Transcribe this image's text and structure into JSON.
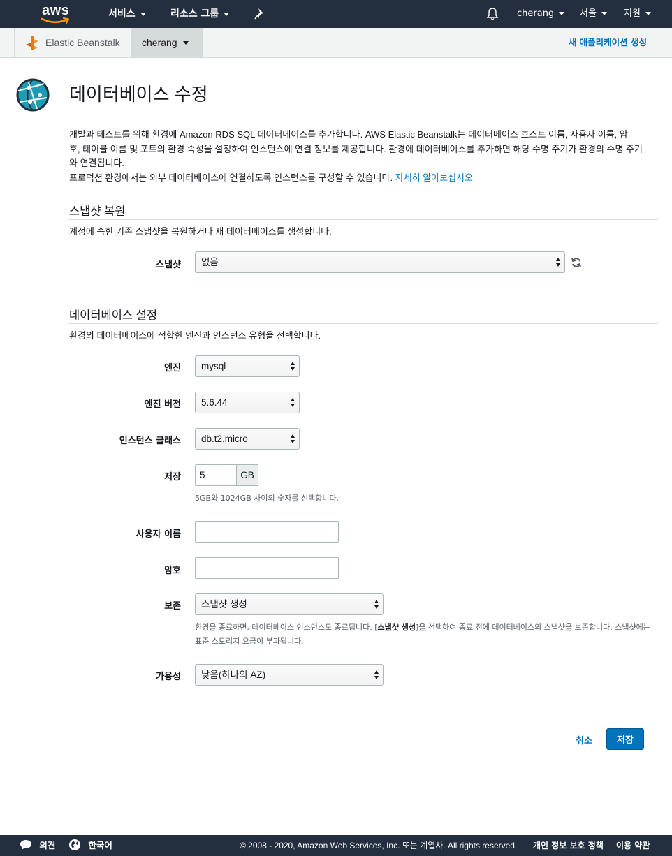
{
  "nav": {
    "logo": "aws",
    "services": "서비스",
    "resource_groups": "리소스 그룹",
    "user": "cherang",
    "region": "서울",
    "support": "지원"
  },
  "subnav": {
    "app_name": "Elastic Beanstalk",
    "environment": "cherang",
    "create_app": "새 애플리케이션 생성"
  },
  "page": {
    "title": "데이터베이스 수정",
    "intro_line1": "개발과 테스트를 위해 환경에 Amazon RDS SQL 데이터베이스를 추가합니다. AWS Elastic Beanstalk는 데이터베이스 호스트 이름, 사용자 이름, 암",
    "intro_line2": "호, 테이블 이름 및 포트의 환경 속성을 설정하여 인스턴스에 연결 정보를 제공합니다. 환경에 데이터베이스를 추가하면 해당 수명 주기가 환경의 수명 주기",
    "intro_line3": "와 연결됩니다.",
    "intro_line4": "프로덕션 환경에서는 외부 데이터베이스에 연결하도록 인스턴스를 구성할 수 있습니다.",
    "learn_more": "자세히 알아보십시오"
  },
  "snapshot_section": {
    "title": "스냅샷 복원",
    "description": "계정에 속한 기존 스냅샷을 복원하거나 새 데이터베이스를 생성합니다.",
    "snapshot_label": "스냅샷",
    "snapshot_value": "없음"
  },
  "db_section": {
    "title": "데이터베이스 설정",
    "description": "환경의 데이터베이스에 적합한 엔진과 인스턴스 유형을 선택합니다.",
    "engine_label": "엔진",
    "engine_value": "mysql",
    "engine_version_label": "엔진 버전",
    "engine_version_value": "5.6.44",
    "instance_class_label": "인스턴스 클래스",
    "instance_class_value": "db.t2.micro",
    "storage_label": "저장",
    "storage_value": "5",
    "storage_unit": "GB",
    "storage_hint": "5GB와 1024GB 사이의 숫자를 선택합니다.",
    "username_label": "사용자 이름",
    "username_value": "",
    "password_label": "암호",
    "password_value": "",
    "retention_label": "보존",
    "retention_value": "스냅샷 생성",
    "retention_hint_pre": "환경을 종료하면, 데이터베이스 인스턴스도 종료됩니다. [",
    "retention_hint_bold": "스냅샷 생성",
    "retention_hint_post": "]을 선택하여 종료 전에 데이터베이스의 스냅샷을 보존합니다. 스냅샷에는",
    "retention_hint_line2": "표준 스토리지 요금이 부과됩니다.",
    "availability_label": "가용성",
    "availability_value": "낮음(하나의 AZ)"
  },
  "actions": {
    "cancel": "취소",
    "save": "저장"
  },
  "footer": {
    "feedback": "의견",
    "language": "한국어",
    "copyright": "© 2008 - 2020, Amazon Web Services, Inc. 또는 계열사. All rights reserved.",
    "privacy": "개인 정보 보호 정책",
    "terms": "이용 약관"
  },
  "colors": {
    "nav_bg": "#232f3e",
    "link": "#0073bb",
    "primary_button": "#0073bb",
    "aws_smile": "#ff9900"
  }
}
